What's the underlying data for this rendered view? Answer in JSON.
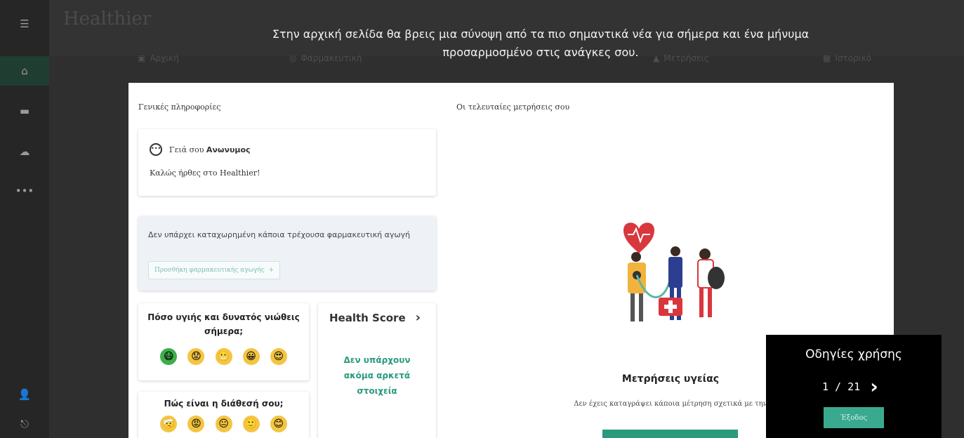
{
  "app": {
    "logo": "Healthier"
  },
  "sidebar": {
    "icons": [
      "menu-icon",
      "home-icon",
      "folder-icon",
      "cloud-icon",
      "more-icon",
      "user-icon",
      "logout-icon"
    ]
  },
  "nav": {
    "tabs": [
      {
        "label": "Αρχική",
        "icon": "home-icon"
      },
      {
        "label": "Φαρμακευτική",
        "icon": "pill-icon"
      },
      {
        "label": "Μετρήσεις",
        "icon": "chart-icon"
      },
      {
        "label": "Ιστορικό",
        "icon": "calendar-icon"
      }
    ]
  },
  "tour": {
    "message": "Στην αρχική σελίδα θα βρεις μια σύνοψη από τα πιο σημαντικά νέα για σήμερα και ένα μήνυμα προσαρμοσμένο στις ανάγκες σου."
  },
  "general": {
    "title": "Γενικές πληροφορίες",
    "greeting_prefix": "Γειά σου",
    "user_name": "Ανωνυμος",
    "welcome": "Καλώς ήρθες στο Healthier!"
  },
  "medication": {
    "empty_text": "Δεν υπάρχει καταχωρημένη κάποια τρέχουσα φαρμακευτική αγωγή",
    "add_button": "Προσθήκη φαρμακευτικής αγωγής",
    "add_icon": "+"
  },
  "wellbeing": {
    "question": "Πόσο υγιής και δυνατός νιώθεις σήμερα;",
    "emojis": [
      "😷",
      "😟",
      "😬",
      "😀",
      "😍"
    ]
  },
  "mood": {
    "question": "Πώς είναι η διάθεσή σου;",
    "emojis": [
      "🤕",
      "😡",
      "😐",
      "🙂",
      "😊"
    ]
  },
  "health_score": {
    "title": "Health Score",
    "chevron": "›",
    "empty": "Δεν υπάρχουν ακόμα αρκετά στοιχεία"
  },
  "measurements": {
    "section_title": "Οι τελευταίες μετρήσεις σου",
    "heading": "Μετρήσεις υγείας",
    "empty_text": "Δεν έχεις καταγράψει κάποια μέτρηση σχετικά με την"
  },
  "tutorial": {
    "title": "Οδηγίες χρήσης",
    "current": 1,
    "total": 21,
    "counter": "1 / 21",
    "next_icon": "›",
    "exit": "Έξοδος"
  },
  "colors": {
    "accent": "#2a9a7d",
    "heart": "#d9363e",
    "dim": "#2f2f2f"
  }
}
